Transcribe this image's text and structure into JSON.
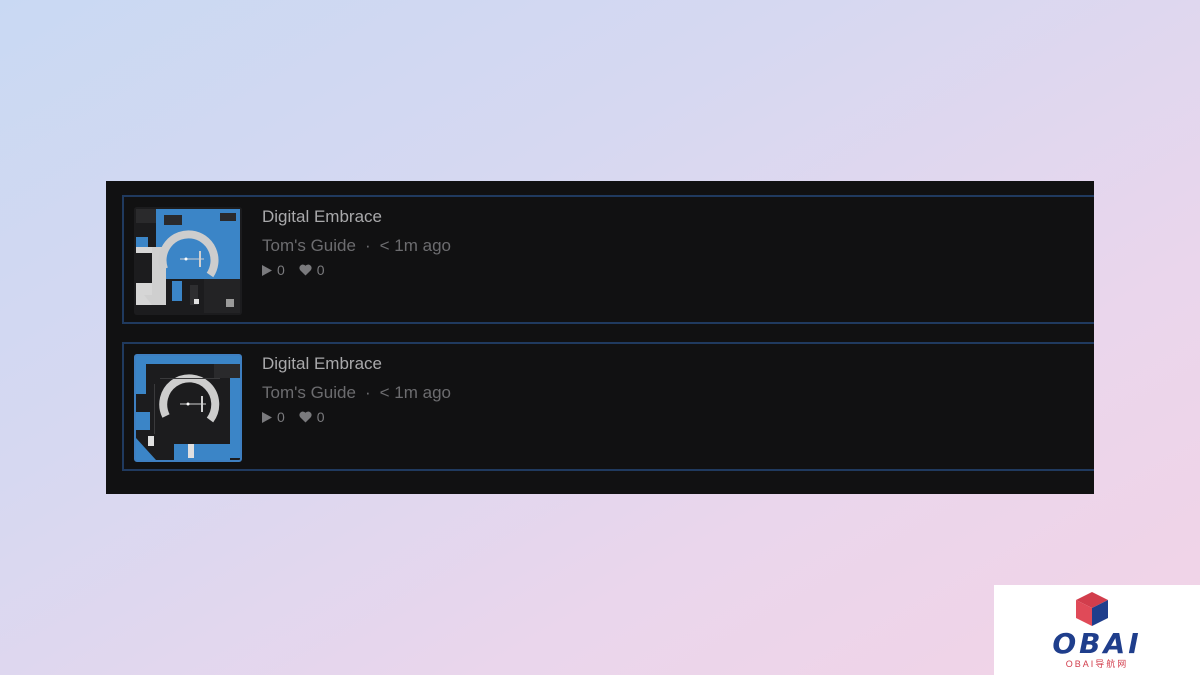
{
  "tracks": [
    {
      "title": "Digital Embrace",
      "author": "Tom's Guide",
      "separator": "·",
      "time": "< 1m ago",
      "plays": "0",
      "likes": "0",
      "thumbnail_icon": "album-art-thumbnail",
      "selected": false
    },
    {
      "title": "Digital Embrace",
      "author": "Tom's Guide",
      "separator": "·",
      "time": "< 1m ago",
      "plays": "0",
      "likes": "0",
      "thumbnail_icon": "album-art-thumbnail",
      "selected": true
    }
  ],
  "logo": {
    "name": "OBAI",
    "subtitle": "OBAI导航网"
  },
  "colors": {
    "panel_bg": "#111112",
    "row_border": "#203a5f",
    "accent_blue": "#3e7fc1",
    "title_text": "#a9a9ab",
    "meta_text": "#6c6c6f",
    "logo_blue": "#1f3e8c",
    "logo_red": "#d23d4c"
  }
}
